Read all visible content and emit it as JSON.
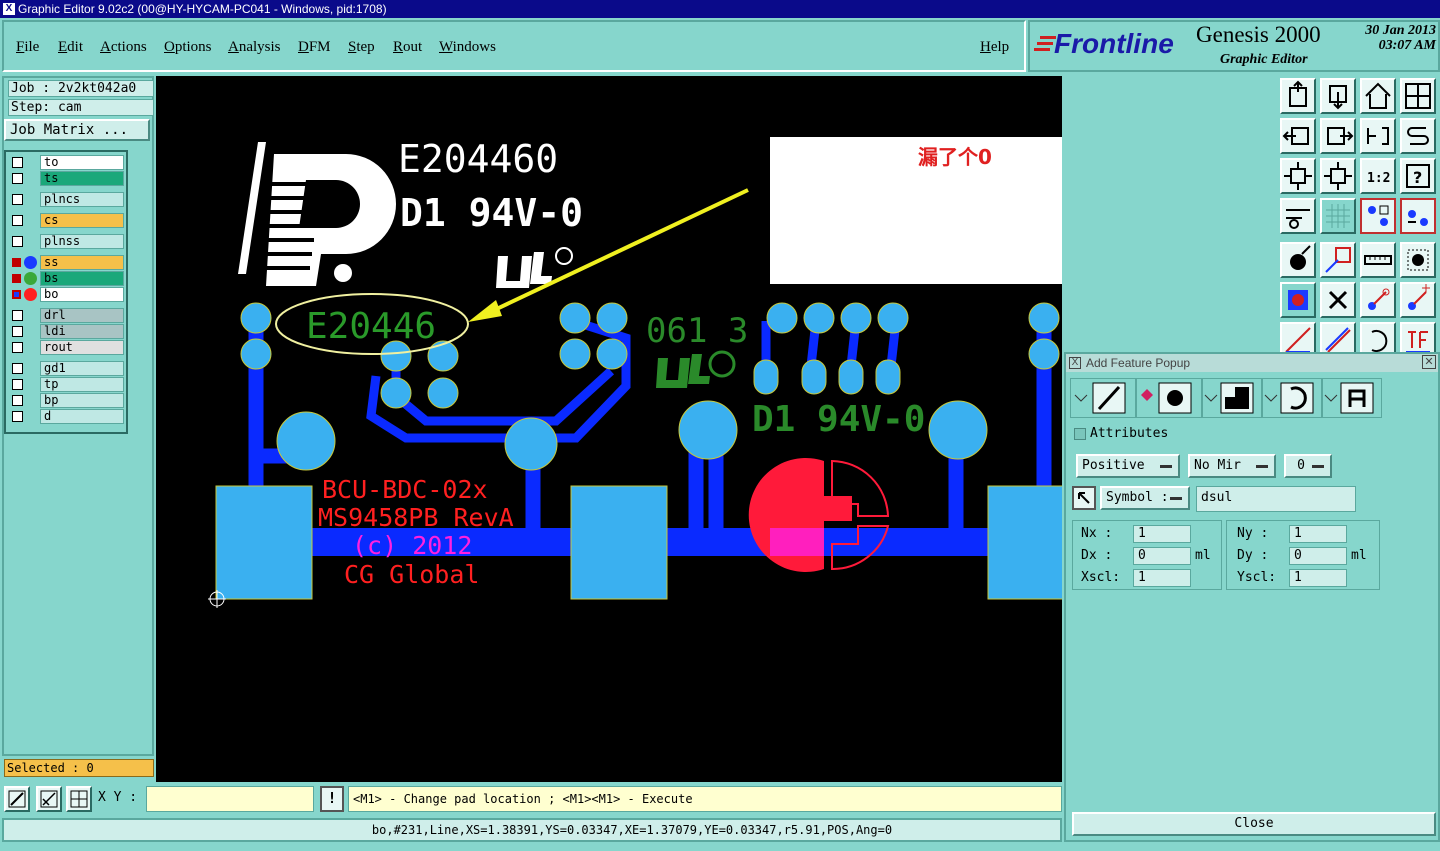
{
  "window": {
    "title": "Graphic Editor 9.02c2 (00@HY-HYCAM-PC041 - Windows, pid:1708)"
  },
  "menu": [
    "File",
    "Edit",
    "Actions",
    "Options",
    "Analysis",
    "DFM",
    "Step",
    "Rout",
    "Windows"
  ],
  "help": "Help",
  "brand": {
    "name": "Frontline",
    "product": "Genesis 2000",
    "module": "Graphic Editor",
    "date": "30 Jan 2013",
    "time": "03:07 AM"
  },
  "job": {
    "job": "Job : 2v2kt042a0",
    "step": "Step: cam",
    "matrix": "Job Matrix ..."
  },
  "layers": [
    {
      "name": "to",
      "color": "#ffffff"
    },
    {
      "name": "ts",
      "color": "#1aa87a"
    },
    {
      "name": "plncs",
      "color": "#bfe8e4"
    },
    {
      "name": "cs",
      "color": "#f5c04a"
    },
    {
      "name": "plnss",
      "color": "#bfe8e4"
    },
    {
      "name": "ss",
      "color": "#f5c04a"
    },
    {
      "name": "bs",
      "color": "#1aa87a"
    },
    {
      "name": "bo",
      "color": "#ffffff"
    },
    {
      "name": "drl",
      "color": "#a8c4c4"
    },
    {
      "name": "ldi",
      "color": "#a8c4c4"
    },
    {
      "name": "rout",
      "color": "#e0e0e0"
    },
    {
      "name": "gd1",
      "color": "#bfe8e4"
    },
    {
      "name": "tp",
      "color": "#bfe8e4"
    },
    {
      "name": "bp",
      "color": "#bfe8e4"
    },
    {
      "name": "d",
      "color": "#bfe8e4"
    }
  ],
  "selected": "Selected : 0",
  "board": {
    "ul_number": "E204460",
    "rating": "D1  94V-0",
    "annotation_note": "漏了个0",
    "circled_text": "E20446",
    "date_code": "061 3",
    "rating2": "D1 94V-0",
    "line1": "BCU-BDC-02x",
    "line2": "MS9458PB RevA",
    "line3": "(c) 2012",
    "line4": "CG Global"
  },
  "bottom": {
    "xy_label": "X Y :",
    "bang": "!",
    "prompt": "<M1> - Change pad location ; <M1><M1> - Execute"
  },
  "status": "bo,#231,Line,XS=1.38391,YS=0.03347,XE=1.37079,YE=0.03347,r5.91,POS,Ang=0",
  "popup": {
    "title": "Add Feature Popup",
    "attributes": "Attributes",
    "polarity": "Positive",
    "mirror": "No Mir",
    "angle": "0",
    "symbol_label": "Symbol :",
    "symbol_value": "dsul",
    "nx_label": "Nx    :",
    "nx": "1",
    "ny_label": "Ny    :",
    "ny": "1",
    "dx_label": "Dx   :",
    "dx": "0",
    "dx_unit": "ml",
    "dy_label": "Dy   :",
    "dy": "0",
    "dy_unit": "ml",
    "xscl_label": "Xscl:",
    "xscl": "1",
    "yscl_label": "Yscl:",
    "yscl": "1",
    "close": "Close"
  }
}
